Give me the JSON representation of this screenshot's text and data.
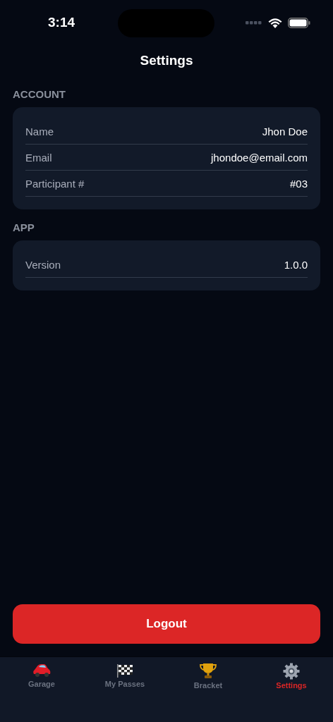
{
  "status_bar": {
    "time": "3:14"
  },
  "header": {
    "title": "Settings"
  },
  "sections": [
    {
      "title": "ACCOUNT",
      "rows": [
        {
          "label": "Name",
          "value": "Jhon Doe"
        },
        {
          "label": "Email",
          "value": "jhondoe@email.com"
        },
        {
          "label": "Participant #",
          "value": "#03"
        }
      ]
    },
    {
      "title": "APP",
      "rows": [
        {
          "label": "Version",
          "value": "1.0.0"
        }
      ]
    }
  ],
  "logout_button": {
    "label": "Logout"
  },
  "tab_bar": [
    {
      "kind": "car",
      "label": "Garage",
      "selected": false
    },
    {
      "kind": "flag",
      "label": "My Passes",
      "selected": false
    },
    {
      "kind": "trophy",
      "label": "Bracket",
      "selected": false
    },
    {
      "kind": "gear",
      "label": "Settings",
      "selected": true
    }
  ]
}
